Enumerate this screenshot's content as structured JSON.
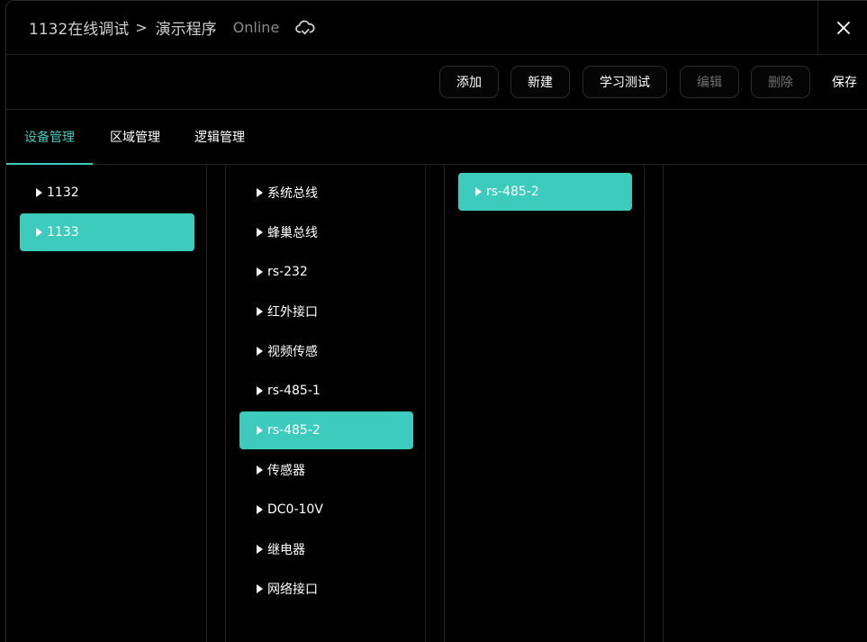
{
  "header": {
    "crumbs": [
      "1132在线调试",
      "演示程序"
    ],
    "separator": ">",
    "status": "Online",
    "cloud_icon": "cloud-sync-icon",
    "close_icon": "close-icon"
  },
  "toolbar": {
    "add_label": "添加",
    "new_label": "新建",
    "learn_test_label": "学习测试",
    "edit_label": "编辑",
    "delete_label": "删除",
    "save_label": "保存"
  },
  "tabs": [
    {
      "label": "设备管理",
      "active": true
    },
    {
      "label": "区域管理",
      "active": false
    },
    {
      "label": "逻辑管理",
      "active": false
    }
  ],
  "columns": {
    "devices": [
      {
        "label": "1132",
        "selected": false
      },
      {
        "label": "1133",
        "selected": true
      }
    ],
    "interfaces": [
      {
        "label": "系统总线",
        "selected": false
      },
      {
        "label": "蜂巢总线",
        "selected": false
      },
      {
        "label": "rs-232",
        "selected": false
      },
      {
        "label": "红外接口",
        "selected": false
      },
      {
        "label": "视频传感",
        "selected": false
      },
      {
        "label": "rs-485-1",
        "selected": false
      },
      {
        "label": "rs-485-2",
        "selected": true
      },
      {
        "label": "传感器",
        "selected": false
      },
      {
        "label": "DC0-10V",
        "selected": false
      },
      {
        "label": "继电器",
        "selected": false
      },
      {
        "label": "网络接口",
        "selected": false
      }
    ],
    "detail": [
      {
        "label": "rs-485-2",
        "selected": true
      }
    ]
  },
  "colors": {
    "accent": "#3ecab9",
    "selected_bg": "#3ccbbd",
    "background": "#000000",
    "disabled_text": "#6e6e6e"
  }
}
